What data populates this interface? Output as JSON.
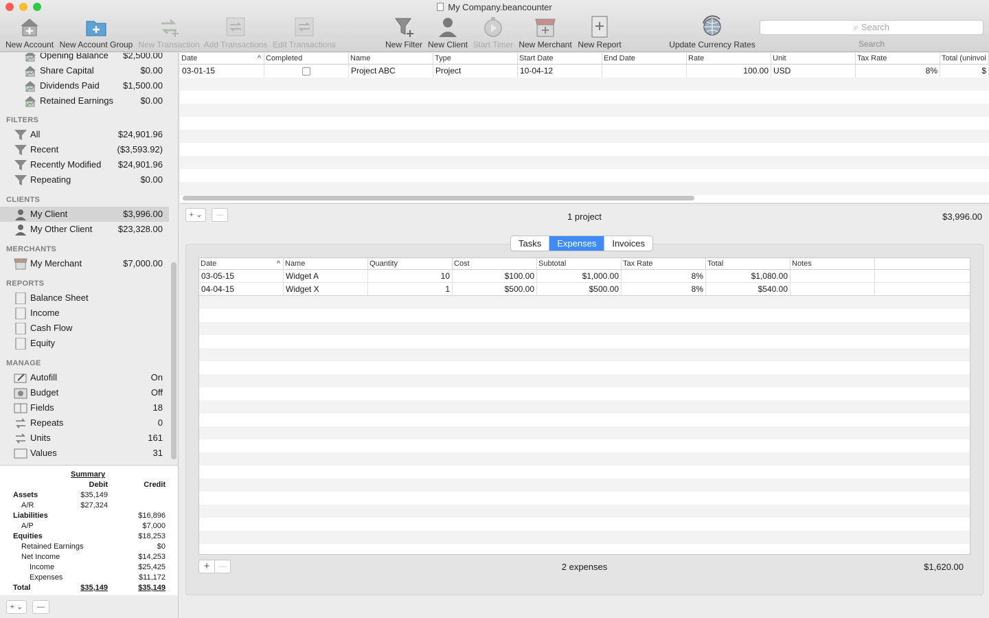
{
  "window": {
    "title": "My Company.beancounter"
  },
  "toolbar": {
    "new_account": "New Account",
    "new_account_group": "New Account Group",
    "new_transaction": "New Transaction",
    "add_transactions": "Add Transactions",
    "edit_transactions": "Edit Transactions",
    "new_filter": "New Filter",
    "new_client": "New Client",
    "start_timer": "Start Timer",
    "new_merchant": "New Merchant",
    "new_report": "New Report",
    "update_currency_rates": "Update Currency Rates",
    "search_placeholder": "Search",
    "search_label": "Search"
  },
  "sidebar": {
    "accounts": [
      {
        "name": "Opening Balance",
        "value": "$2,500.00"
      },
      {
        "name": "Share Capital",
        "value": "$0.00"
      },
      {
        "name": "Dividends Paid",
        "value": "$1,500.00"
      },
      {
        "name": "Retained Earnings",
        "value": "$0.00"
      }
    ],
    "filters_heading": "FILTERS",
    "filters": [
      {
        "name": "All",
        "value": "$24,901.96"
      },
      {
        "name": "Recent",
        "value": "($3,593.92)"
      },
      {
        "name": "Recently Modified",
        "value": "$24,901.96"
      },
      {
        "name": "Repeating",
        "value": "$0.00"
      }
    ],
    "clients_heading": "CLIENTS",
    "clients": [
      {
        "name": "My Client",
        "value": "$3,996.00"
      },
      {
        "name": "My Other Client",
        "value": "$23,328.00"
      }
    ],
    "merchants_heading": "MERCHANTS",
    "merchants": [
      {
        "name": "My Merchant",
        "value": "$7,000.00"
      }
    ],
    "reports_heading": "REPORTS",
    "reports": [
      {
        "name": "Balance Sheet"
      },
      {
        "name": "Income"
      },
      {
        "name": "Cash Flow"
      },
      {
        "name": "Equity"
      }
    ],
    "manage_heading": "MANAGE",
    "manage": [
      {
        "name": "Autofill",
        "value": "On"
      },
      {
        "name": "Budget",
        "value": "Off"
      },
      {
        "name": "Fields",
        "value": "18"
      },
      {
        "name": "Repeats",
        "value": "0"
      },
      {
        "name": "Units",
        "value": "161"
      },
      {
        "name": "Values",
        "value": "31"
      }
    ]
  },
  "summary": {
    "title": "Summary",
    "debit": "Debit",
    "credit": "Credit",
    "rows": [
      {
        "label": "Assets",
        "debit": "$35,149",
        "credit": ""
      },
      {
        "label": "A/R",
        "debit": "$27,324",
        "credit": ""
      },
      {
        "label": "Liabilities",
        "debit": "",
        "credit": "$16,896"
      },
      {
        "label": "A/P",
        "debit": "",
        "credit": "$7,000"
      },
      {
        "label": "Equities",
        "debit": "",
        "credit": "$18,253"
      },
      {
        "label": "Retained Earnings",
        "debit": "",
        "credit": "$0"
      },
      {
        "label": "Net Income",
        "debit": "",
        "credit": "$14,253"
      },
      {
        "label": "Income",
        "debit": "",
        "credit": "$25,425"
      },
      {
        "label": "Expenses",
        "debit": "",
        "credit": "$11,172"
      },
      {
        "label": "Total",
        "debit": "$35,149",
        "credit": "$35,149"
      }
    ]
  },
  "projects": {
    "columns": [
      "Date",
      "Completed",
      "Name",
      "Type",
      "Start Date",
      "End Date",
      "Rate",
      "Unit",
      "Tax Rate",
      "Total (uninvoi"
    ],
    "rows": [
      {
        "date": "03-01-15",
        "completed": false,
        "name": "Project ABC",
        "type": "Project",
        "start_date": "10-04-12",
        "end_date": "",
        "rate": "100.00",
        "unit": "USD",
        "tax_rate": "8%",
        "total": "$"
      }
    ],
    "count_label": "1 project",
    "total": "$3,996.00",
    "add_label": "+",
    "remove_label": "—"
  },
  "tabs": [
    "Tasks",
    "Expenses",
    "Invoices"
  ],
  "active_tab": "Expenses",
  "expenses": {
    "columns": [
      "Date",
      "Name",
      "Quantity",
      "Cost",
      "Subtotal",
      "Tax Rate",
      "Total",
      "Notes"
    ],
    "rows": [
      {
        "date": "03-05-15",
        "name": "Widget A",
        "quantity": "10",
        "cost": "$100.00",
        "subtotal": "$1,000.00",
        "tax_rate": "8%",
        "total": "$1,080.00",
        "notes": ""
      },
      {
        "date": "04-04-15",
        "name": "Widget X",
        "quantity": "1",
        "cost": "$500.00",
        "subtotal": "$500.00",
        "tax_rate": "8%",
        "total": "$540.00",
        "notes": ""
      }
    ],
    "count_label": "2 expenses",
    "total": "$1,620.00",
    "add_label": "+",
    "remove_label": "—"
  },
  "sidebar_footer": {
    "add_label": "+ ⌄",
    "remove_label": "—"
  },
  "colors": {
    "accent": "#3f8cf5",
    "close": "#fc5f57",
    "minimize": "#fdbc2e",
    "zoom": "#33c748"
  }
}
